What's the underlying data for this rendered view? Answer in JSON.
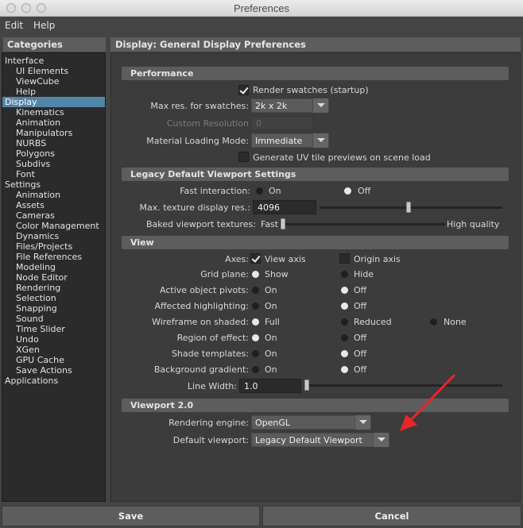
{
  "window": {
    "title": "Preferences"
  },
  "menubar": {
    "items": [
      "Edit",
      "Help"
    ]
  },
  "categories": {
    "header": "Categories",
    "items": [
      "Interface",
      "UI Elements",
      "ViewCube",
      "Help",
      "Display",
      "Kinematics",
      "Animation",
      "Manipulators",
      "NURBS",
      "Polygons",
      "Subdivs",
      "Font",
      "Settings",
      "Animation",
      "Assets",
      "Cameras",
      "Color Management",
      "Dynamics",
      "Files/Projects",
      "File References",
      "Modeling",
      "Node Editor",
      "Rendering",
      "Selection",
      "Snapping",
      "Sound",
      "Time Slider",
      "Undo",
      "XGen",
      "GPU Cache",
      "Save Actions",
      "Applications"
    ],
    "selected": "Display"
  },
  "panel": {
    "header": "Display: General Display Preferences",
    "performance": {
      "title": "Performance",
      "render_swatches": {
        "label": "Render swatches (startup)",
        "checked": true
      },
      "max_res": {
        "label": "Max res. for swatches:",
        "value": "2k x 2k"
      },
      "custom_res": {
        "label": "Custom Resolution",
        "value": "0"
      },
      "material_loading": {
        "label": "Material Loading Mode:",
        "value": "Immediate"
      },
      "uv_previews": {
        "label": "Generate UV tile previews on scene load",
        "checked": false
      }
    },
    "legacy": {
      "title": "Legacy Default Viewport Settings",
      "fast_interaction": {
        "label": "Fast interaction:",
        "on": "On",
        "off": "Off",
        "value": "Off"
      },
      "max_texture": {
        "label": "Max. texture display res.:",
        "value": "4096"
      },
      "baked_textures": {
        "label": "Baked viewport textures:",
        "min_label": "Fast",
        "max_label": "High quality",
        "level": 0.0
      }
    },
    "view": {
      "title": "View",
      "axes": {
        "label": "Axes:",
        "view_axis": "View axis",
        "view_axis_checked": true,
        "origin_axis": "Origin axis",
        "origin_axis_checked": false
      },
      "grid_plane": {
        "label": "Grid plane:",
        "a": "Show",
        "b": "Hide",
        "value": "Show"
      },
      "active_pivots": {
        "label": "Active object pivots:",
        "a": "On",
        "b": "Off",
        "value": "Off"
      },
      "affected_highlighting": {
        "label": "Affected highlighting:",
        "a": "On",
        "b": "Off",
        "value": "Off"
      },
      "wireframe_shaded": {
        "label": "Wireframe on shaded:",
        "a": "Full",
        "b": "Reduced",
        "c": "None",
        "value": "Full"
      },
      "region_of_effect": {
        "label": "Region of effect:",
        "a": "On",
        "b": "Off",
        "value": "On"
      },
      "shade_templates": {
        "label": "Shade templates:",
        "a": "On",
        "b": "Off",
        "value": "Off"
      },
      "background_gradient": {
        "label": "Background gradient:",
        "a": "On",
        "b": "Off",
        "value": "Off"
      },
      "line_width": {
        "label": "Line Width:",
        "value": "1.0"
      }
    },
    "viewport2": {
      "title": "Viewport 2.0",
      "rendering_engine": {
        "label": "Rendering engine:",
        "value": "OpenGL"
      },
      "default_viewport": {
        "label": "Default viewport:",
        "value": "Legacy Default Viewport"
      }
    }
  },
  "buttons": {
    "save": "Save",
    "cancel": "Cancel"
  },
  "colors": {
    "selected": "#5285a6",
    "annotation_arrow": "#e8262a",
    "panel_bg": "#3c3c3c",
    "section_bar": "#5d5d5d"
  }
}
